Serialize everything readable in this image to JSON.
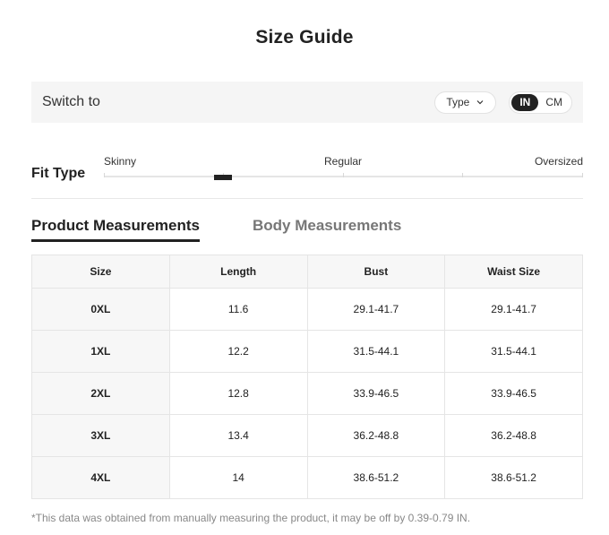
{
  "title": "Size Guide",
  "switch_bar": {
    "label": "Switch to",
    "type_select": "Type",
    "units": [
      {
        "label": "IN",
        "active": true
      },
      {
        "label": "CM",
        "active": false
      }
    ]
  },
  "fit": {
    "label": "Fit Type",
    "scale": [
      "Skinny",
      "Regular",
      "Oversized"
    ],
    "level": 0.25
  },
  "tabs": [
    {
      "label": "Product Measurements",
      "active": true
    },
    {
      "label": "Body Measurements",
      "active": false
    }
  ],
  "table": {
    "headers": [
      "Size",
      "Length",
      "Bust",
      "Waist Size"
    ],
    "rows": [
      [
        "0XL",
        "11.6",
        "29.1-41.7",
        "29.1-41.7"
      ],
      [
        "1XL",
        "12.2",
        "31.5-44.1",
        "31.5-44.1"
      ],
      [
        "2XL",
        "12.8",
        "33.9-46.5",
        "33.9-46.5"
      ],
      [
        "3XL",
        "13.4",
        "36.2-48.8",
        "36.2-48.8"
      ],
      [
        "4XL",
        "14",
        "38.6-51.2",
        "38.6-51.2"
      ]
    ]
  },
  "note": "*This data was obtained from manually measuring the product, it may be off by 0.39-0.79 IN.",
  "icons": {
    "type_select": "chevron-down-icon"
  }
}
